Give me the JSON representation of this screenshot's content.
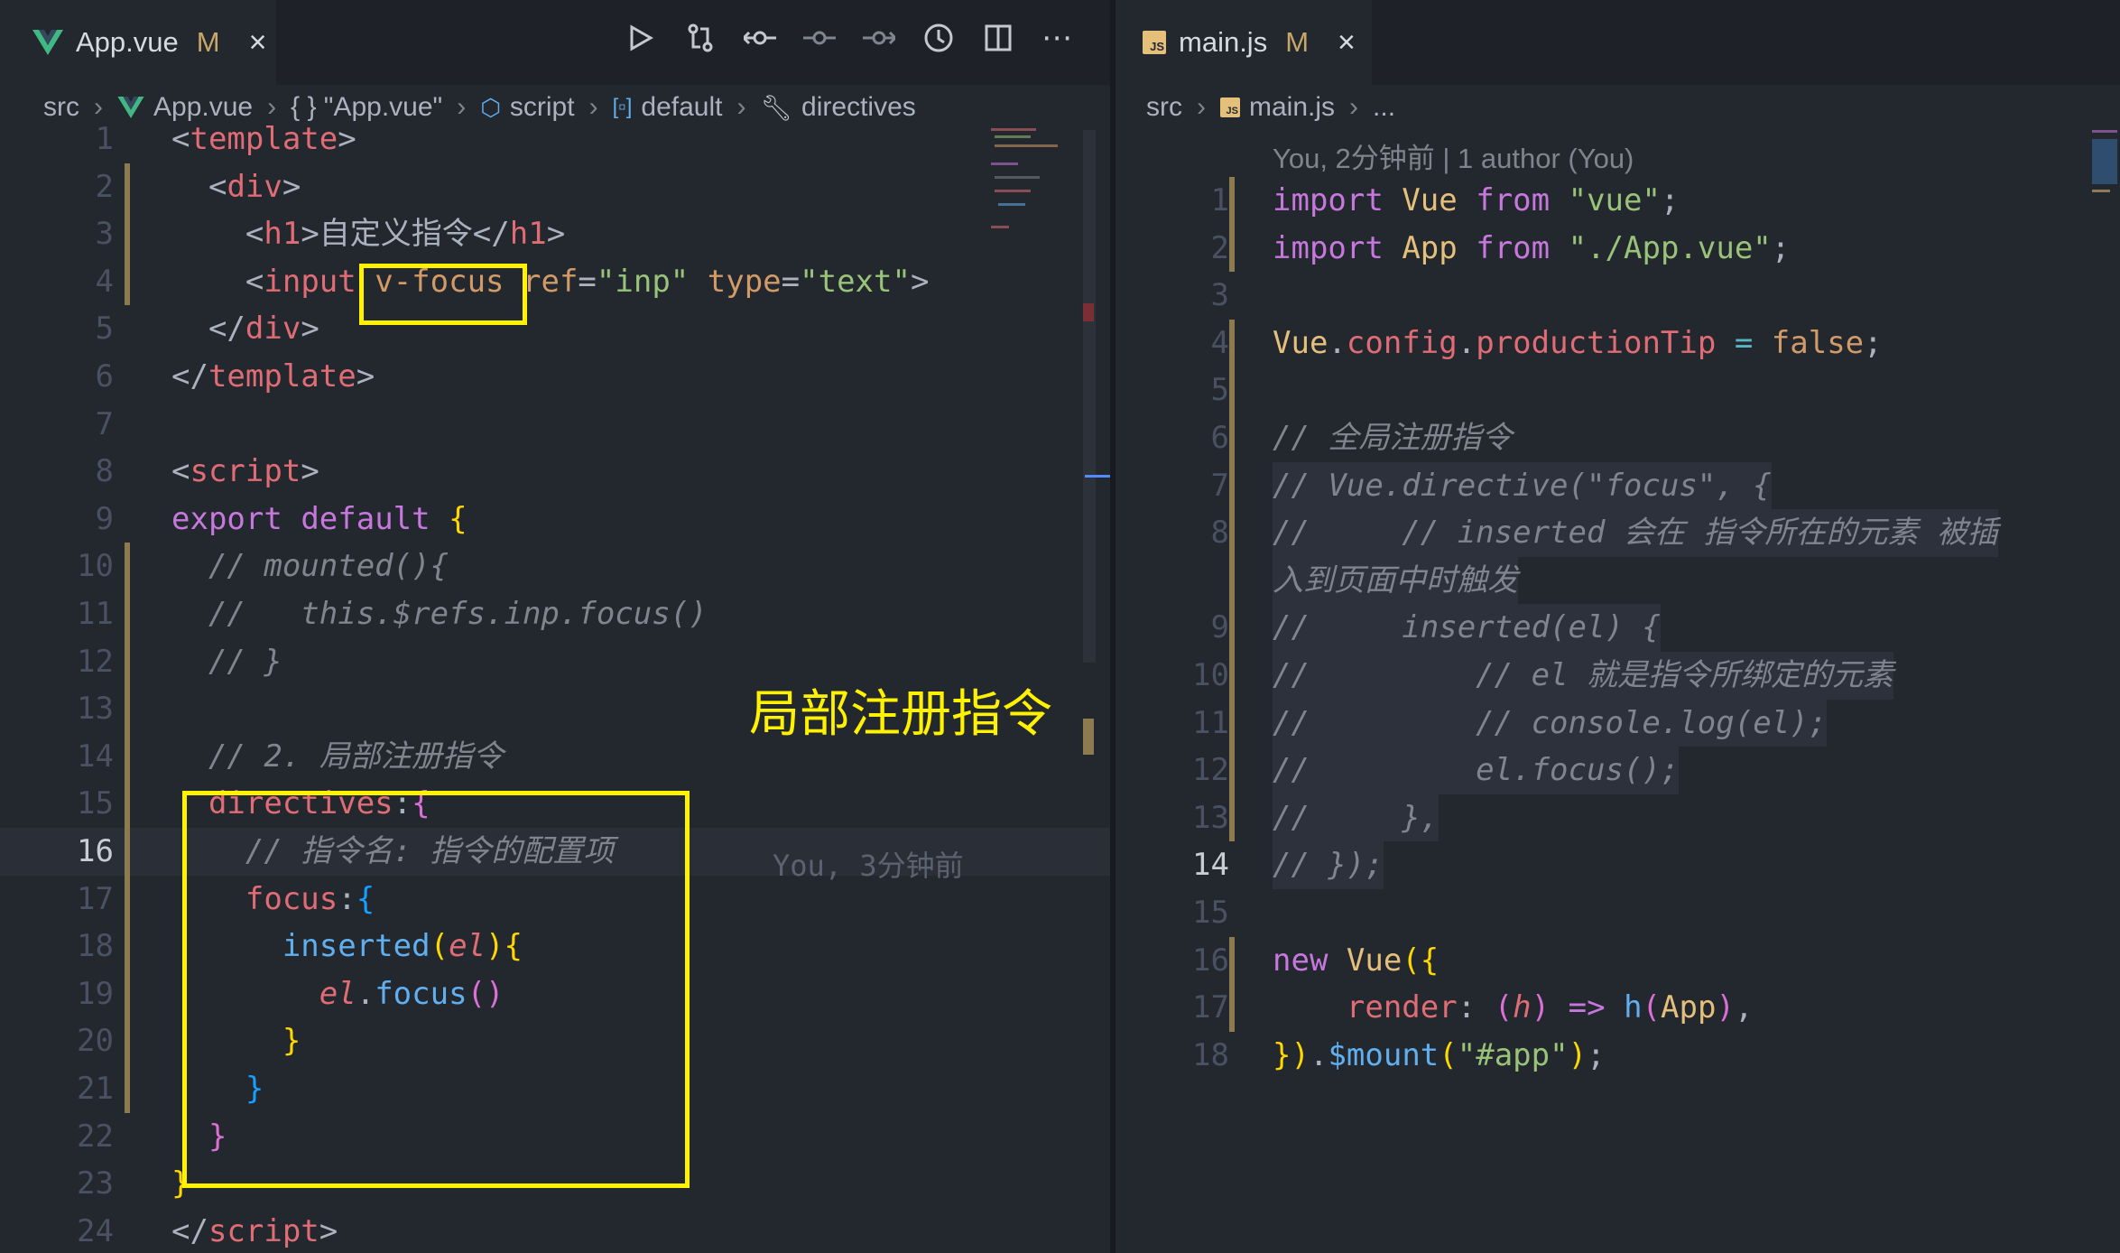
{
  "left": {
    "tab": {
      "name": "App.vue",
      "mod": "M",
      "close": "×"
    },
    "actions": [
      "run-icon",
      "compare-changes-icon",
      "git-commit-icon",
      "previous-change-icon",
      "next-change-icon",
      "timeline-icon",
      "split-editor-icon",
      "more-actions-icon"
    ],
    "breadcrumb": [
      "src",
      "App.vue",
      "{ } \"App.vue\"",
      "script",
      "default",
      "directives"
    ],
    "lines": [
      {
        "n": "1",
        "html": "<span class='tk-p'>&lt;</span><span class='tk-tag'>template</span><span class='tk-p'>&gt;</span>"
      },
      {
        "n": "2",
        "html": "  <span class='tk-p'>&lt;</span><span class='tk-tag'>div</span><span class='tk-p'>&gt;</span>"
      },
      {
        "n": "3",
        "html": "    <span class='tk-p'>&lt;</span><span class='tk-tag'>h1</span><span class='tk-p'>&gt;自定义指令&lt;/</span><span class='tk-tag'>h1</span><span class='tk-p'>&gt;</span>"
      },
      {
        "n": "4",
        "html": "    <span class='tk-p'>&lt;</span><span class='tk-tag'>input</span> <span class='tk-attr'>v-focus</span> <span class='tk-attr'>ref</span><span class='tk-p'>=</span><span class='tk-str'>\"inp\"</span> <span class='tk-attr'>type</span><span class='tk-p'>=</span><span class='tk-str'>\"text\"</span><span class='tk-p'>&gt;</span>"
      },
      {
        "n": "5",
        "html": "  <span class='tk-p'>&lt;/</span><span class='tk-tag'>div</span><span class='tk-p'>&gt;</span>"
      },
      {
        "n": "6",
        "html": "<span class='tk-p'>&lt;/</span><span class='tk-tag'>template</span><span class='tk-p'>&gt;</span>"
      },
      {
        "n": "7",
        "html": ""
      },
      {
        "n": "8",
        "html": "<span class='tk-p'>&lt;</span><span class='tk-tag'>script</span><span class='tk-p'>&gt;</span>"
      },
      {
        "n": "9",
        "html": "<span class='tk-kw'>export</span> <span class='tk-kw'>default</span> <span class='tk-b1'>{</span>"
      },
      {
        "n": "10",
        "html": "  <span class='tk-cm'>// mounted(){</span>"
      },
      {
        "n": "11",
        "html": "  <span class='tk-cm'>//   this.$refs.inp.focus()</span>"
      },
      {
        "n": "12",
        "html": "  <span class='tk-cm'>// }</span>"
      },
      {
        "n": "13",
        "html": ""
      },
      {
        "n": "14",
        "html": "  <span class='tk-cm'>// 2. 局部注册指令</span>"
      },
      {
        "n": "15",
        "html": "  <span class='tk-prop'>directives</span><span class='tk-p'>:</span><span class='tk-b2'>{</span>"
      },
      {
        "n": "16",
        "html": "    <span class='tk-cm'>// 指令名: 指令的配置项</span>"
      },
      {
        "n": "17",
        "html": "    <span class='tk-prop'>focus</span><span class='tk-p'>:</span><span class='tk-b3'>{</span>"
      },
      {
        "n": "18",
        "html": "      <span class='tk-fun'>inserted</span><span class='tk-b1'>(</span><span class='tk-it'>el</span><span class='tk-b1'>){</span>"
      },
      {
        "n": "19",
        "html": "        <span class='tk-it'>el</span><span class='tk-p'>.</span><span class='tk-fun'>focus</span><span class='tk-b2'>()</span>"
      },
      {
        "n": "20",
        "html": "      <span class='tk-b1'>}</span>"
      },
      {
        "n": "21",
        "html": "    <span class='tk-b3'>}</span>"
      },
      {
        "n": "22",
        "html": "  <span class='tk-b2'>}</span>"
      },
      {
        "n": "23",
        "html": "<span class='tk-b1'>}</span>"
      },
      {
        "n": "24",
        "html": "<span class='tk-p'>&lt;/</span><span class='tk-tag'>script</span><span class='tk-p'>&gt;</span>"
      }
    ],
    "blame": "You, 3分钟前",
    "annotation": "局部注册指令"
  },
  "right": {
    "tab": {
      "name": "main.js",
      "mod": "M",
      "close": "×"
    },
    "breadcrumb": [
      "src",
      "main.js",
      "..."
    ],
    "author": "You, 2分钟前 | 1 author (You)",
    "lines": [
      {
        "n": "1",
        "html": "<span class='tk-kw'>import</span> <span class='tk-var'>Vue</span> <span class='tk-kw'>from</span> <span class='tk-str'>\"vue\"</span><span class='tk-p'>;</span>"
      },
      {
        "n": "2",
        "html": "<span class='tk-kw'>import</span> <span class='tk-var'>App</span> <span class='tk-kw'>from</span> <span class='tk-str'>\"./App.vue\"</span><span class='tk-p'>;</span>"
      },
      {
        "n": "3",
        "html": ""
      },
      {
        "n": "4",
        "html": "<span class='tk-obj'>Vue</span><span class='tk-p'>.</span><span class='tk-prop'>config</span><span class='tk-p'>.</span><span class='tk-prop'>productionTip</span> <span class='tk-op'>=</span> <span class='tk-bool'>false</span><span class='tk-p'>;</span>"
      },
      {
        "n": "5",
        "html": ""
      },
      {
        "n": "6",
        "html": "<span class='tk-cm'>// 全局注册指令</span>"
      },
      {
        "n": "7",
        "html": "<span class='tk-cm'>// Vue.directive(\"focus\", {</span>"
      },
      {
        "n": "8",
        "html": "<span class='tk-cm'>//     // inserted 会在 指令所在的元素 被插</span>"
      },
      {
        "n": "",
        "html": "<span class='tk-cm'>入到页面中时触发</span>"
      },
      {
        "n": "9",
        "html": "<span class='tk-cm'>//     inserted(el) {</span>"
      },
      {
        "n": "10",
        "html": "<span class='tk-cm'>//         // el 就是指令所绑定的元素</span>"
      },
      {
        "n": "11",
        "html": "<span class='tk-cm'>//         // console.log(el);</span>"
      },
      {
        "n": "12",
        "html": "<span class='tk-cm'>//         el.focus();</span>"
      },
      {
        "n": "13",
        "html": "<span class='tk-cm'>//     },</span>"
      },
      {
        "n": "14",
        "html": "<span class='tk-cm'>// });</span>"
      },
      {
        "n": "15",
        "html": ""
      },
      {
        "n": "16",
        "html": "<span class='tk-kw'>new</span> <span class='tk-var'>Vue</span><span class='tk-b1'>({</span>"
      },
      {
        "n": "17",
        "html": "    <span class='tk-prop'>render</span><span class='tk-p'>:</span> <span class='tk-b2'>(</span><span class='tk-it'>h</span><span class='tk-b2'>)</span> <span class='tk-kw'>=&gt;</span> <span class='tk-fun'>h</span><span class='tk-b2'>(</span><span class='tk-var'>App</span><span class='tk-b2'>)</span><span class='tk-p'>,</span>"
      },
      {
        "n": "18",
        "html": "<span class='tk-b1'>})</span><span class='tk-p'>.</span><span class='tk-fun'>$mount</span><span class='tk-b1'>(</span><span class='tk-str'>\"#app\"</span><span class='tk-b1'>)</span><span class='tk-p'>;</span>"
      }
    ]
  }
}
